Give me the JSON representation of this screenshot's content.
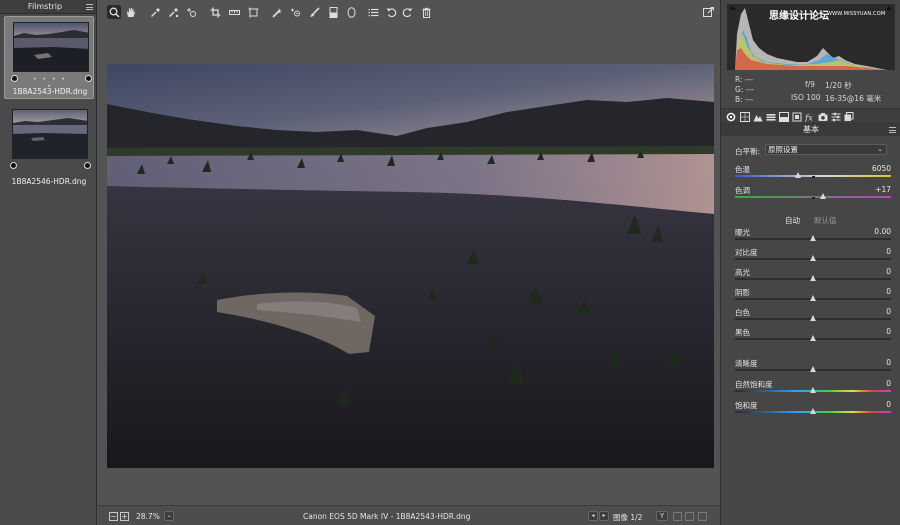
{
  "filmstrip": {
    "title": "Filmstrip",
    "items": [
      {
        "name": "1B8A2543-HDR.dng",
        "selected": true,
        "stars": "• • • • •"
      },
      {
        "name": "1B8A2546-HDR.dng",
        "selected": false,
        "stars": ""
      }
    ]
  },
  "toolbar": {
    "tools": [
      "zoom-icon",
      "hand-icon",
      "white-balance-icon",
      "color-sampler-icon",
      "target-adjust-icon",
      "crop-icon",
      "straighten-icon",
      "transform-icon",
      "spot-removal-icon",
      "red-eye-icon",
      "adjustment-brush-icon",
      "graduated-filter-icon",
      "radial-filter-icon",
      "preferences-icon",
      "rotate-ccw-icon",
      "rotate-cw-icon",
      "trash-icon"
    ],
    "fullscreen_icon": "fullscreen-icon"
  },
  "status": {
    "zoom": "28.7%",
    "file_info": "Canon EOS 5D Mark IV  -  1B8A2543-HDR.dng",
    "image_counter": "图像 1/2",
    "view_mode": "Y"
  },
  "histogram": {
    "watermark": "思缘设计论坛",
    "watermark_sub": "WWW.MISSYUAN.COM",
    "rgb": [
      {
        "label": "R:",
        "value": "---"
      },
      {
        "label": "G:",
        "value": "---"
      },
      {
        "label": "B:",
        "value": "---"
      }
    ],
    "exif": {
      "aperture": "f/9",
      "shutter": "1/20 秒",
      "iso": "ISO 100",
      "lens": "16-35@16 毫米"
    }
  },
  "panel": {
    "section_title": "基本",
    "white_balance_label": "白平衡:",
    "white_balance_value": "原照设置",
    "auto_label": "自动",
    "default_label": "默认值",
    "sliders": [
      {
        "label": "色温",
        "value": "6050",
        "position": 0.41,
        "type": "temp"
      },
      {
        "label": "色调",
        "value": "+17",
        "position": 0.57,
        "type": "tint"
      },
      {
        "label": "曝光",
        "value": "0.00",
        "position": 0.5,
        "type": "plain"
      },
      {
        "label": "对比度",
        "value": "0",
        "position": 0.5,
        "type": "plain"
      },
      {
        "label": "高光",
        "value": "0",
        "position": 0.5,
        "type": "plain"
      },
      {
        "label": "阴影",
        "value": "0",
        "position": 0.5,
        "type": "plain"
      },
      {
        "label": "白色",
        "value": "0",
        "position": 0.5,
        "type": "plain"
      },
      {
        "label": "黑色",
        "value": "0",
        "position": 0.5,
        "type": "plain"
      },
      {
        "label": "清晰度",
        "value": "0",
        "position": 0.5,
        "type": "plain"
      },
      {
        "label": "自然饱和度",
        "value": "0",
        "position": 0.5,
        "type": "sat"
      },
      {
        "label": "饱和度",
        "value": "0",
        "position": 0.5,
        "type": "sat"
      }
    ]
  },
  "colors": {
    "accent_blue": "#7aa0d8",
    "selected_thumb": "#7a7a7a",
    "panel_bg": "#464646"
  }
}
